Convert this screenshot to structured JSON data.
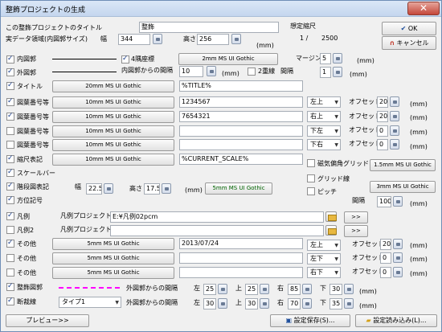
{
  "window": {
    "title": "整飾プロジェクトの生成",
    "close": "✕"
  },
  "header": {
    "project_title_label": "この整飾プロジェクトのタイトル",
    "project_title_value": "整飾",
    "data_range_label": "実データ領域(内図郭サイズ)",
    "width_label": "幅",
    "width_value": "344",
    "height_label": "高さ",
    "height_value": "256",
    "unit_mm": "(mm)",
    "scale_label": "想定縮尺",
    "scale_prefix": "1 /",
    "scale_value": "2500",
    "ok": "OK",
    "cancel": "キャンセル"
  },
  "rows": {
    "inner_frame": {
      "label": "内図郭",
      "ticks_label": "4隅座標",
      "font": "2mm MS UI Gothic",
      "margin_label": "マージン",
      "margin_value": "5",
      "unit": "(mm)"
    },
    "outer_frame": {
      "label": "外図郭",
      "gap_label": "内図郭からの間隔",
      "gap_value": "10",
      "gap_unit": "(mm)",
      "double_label": "2重線",
      "interval_label": "間隔",
      "interval_value": "1",
      "interval_unit": "(mm)"
    },
    "title": {
      "label": "タイトル",
      "font": "20mm MS UI Gothic",
      "value": "%TITLE%"
    },
    "sheet1": {
      "label": "図葉番号等",
      "font": "10mm MS UI Gothic",
      "value": "1234567",
      "pos": "左上",
      "offset_label": "オフセット",
      "offset_value": "20",
      "unit": "(mm)"
    },
    "sheet2": {
      "label": "図葉番号等",
      "font": "10mm MS UI Gothic",
      "value": "7654321",
      "pos": "右上",
      "offset_label": "オフセット",
      "offset_value": "20",
      "unit": "(mm)"
    },
    "sheet3": {
      "label": "図葉番号等",
      "font": "10mm MS UI Gothic",
      "value": "",
      "pos": "下左",
      "offset_label": "オフセット",
      "offset_value": "0",
      "unit": "(mm)"
    },
    "sheet4": {
      "label": "図葉番号等",
      "font": "10mm MS UI Gothic",
      "value": "",
      "pos": "下右",
      "offset_label": "オフセット",
      "offset_value": "0",
      "unit": "(mm)"
    },
    "scale_text": {
      "label": "縮尺表記",
      "font": "10mm MS UI Gothic",
      "value": "%CURRENT_SCALE%"
    },
    "magnetic": {
      "label": "磁気偏角グリッド",
      "font": "1.5mm MS UI Gothic"
    },
    "scalebar": {
      "label": "スケールバー"
    },
    "grid_line": {
      "label": "グリッド線"
    },
    "pitch": {
      "label": "ピッチ",
      "font": "3mm MS UI Gothic",
      "spacing_label": "間隔",
      "spacing_value": "100",
      "unit": "(mm)"
    },
    "sign": {
      "label": "階段図表記",
      "width_label": "幅",
      "width_value": "22.5",
      "height_label": "高さ",
      "height_value": "17.5",
      "unit": "(mm)",
      "font": "5mm MS UI Gothic"
    },
    "north": {
      "label": "方位記号"
    },
    "legend": {
      "label": "凡例",
      "project_label": "凡例プロジェクト",
      "project_value": "E:¥凡例02pcm",
      "more": ">>"
    },
    "legend2": {
      "label": "凡例2",
      "project_label": "凡例プロジェクト",
      "project_value": "",
      "more": ">>"
    },
    "other1": {
      "label": "その他",
      "font": "5mm MS UI Gothic",
      "value": "2013/07/24",
      "pos": "左上",
      "offset_label": "オフセット",
      "offset_value": "20",
      "unit": "(mm)"
    },
    "other2": {
      "label": "その他",
      "font": "5mm MS UI Gothic",
      "value": "",
      "pos": "左下",
      "offset_label": "オフセット",
      "offset_value": "0",
      "unit": "(mm)"
    },
    "other3": {
      "label": "その他",
      "font": "5mm MS UI Gothic",
      "value": "",
      "pos": "右下",
      "offset_label": "オフセット",
      "offset_value": "0",
      "unit": "(mm)"
    },
    "trim": {
      "label": "整飾図郭",
      "gap_label": "外図郭からの間隔",
      "l": "左",
      "l_val": "25",
      "t": "上",
      "t_val": "25",
      "r": "右",
      "r_val": "85",
      "b": "下",
      "b_val": "30",
      "unit": "(mm)"
    },
    "cut": {
      "label": "断裁線",
      "type": "タイプ1",
      "gap_label": "外図郭からの間隔",
      "l": "左",
      "l_val": "30",
      "t": "上",
      "t_val": "30",
      "r": "右",
      "r_val": "70",
      "b": "下",
      "b_val": "35",
      "unit": "(mm)"
    }
  },
  "footer": {
    "preview": "プレビュー>>",
    "save": "設定保存(S)...",
    "load": "設定読み込み(L)..."
  },
  "colors": {
    "trim_line": "#ff00ff",
    "accent_ok": "#1f4f9c",
    "cancel_icon": "#c0392b"
  }
}
